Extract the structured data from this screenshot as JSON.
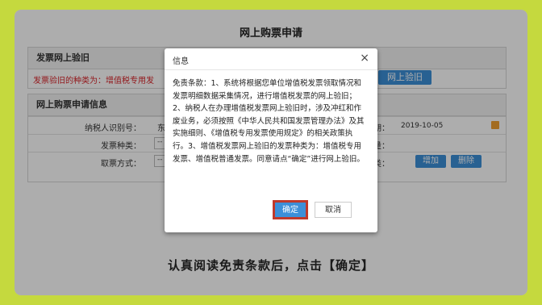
{
  "page_title": "网上购票申请",
  "verify_panel": {
    "title": "发票网上验旧",
    "type_text": "发票验旧的种类为：增值税专用发",
    "verify_button": "网上验旧"
  },
  "info_panel": {
    "title": "网上购票申请信息",
    "taxpayer_label": "纳税人识别号：",
    "taxpayer_value": "东",
    "invoice_type_label": "发票种类：",
    "invoice_type_value": "--",
    "pickup_label": "取票方式：",
    "pickup_value": "--",
    "date_label": "日期：",
    "date_value": "2019-10-05",
    "quantity_label": "数量：",
    "kind_label": "种类：",
    "add_button": "增加",
    "delete_button": "删除"
  },
  "dialog": {
    "title": "信息",
    "close": "×",
    "body": "免责条款：1、系统将根据您单位增值税发票领取情况和发票明细数据采集情况，进行增值税发票的网上验旧；2、纳税人在办理增值税发票网上验旧时，涉及冲红和作废业务，必须按照《中华人民共和国发票管理办法》及其实施细则、《增值税专用发票使用规定》的相关政策执行。3、增值税发票网上验旧的发票种类为：增值税专用发票、增值税普通发票。同意请点“确定”进行网上验旧。",
    "confirm": "确定",
    "cancel": "取消"
  },
  "caption": "认真阅读免责条款后，点击【确定】",
  "colors": {
    "border": "#c5d93e",
    "accent": "#3c8fd8",
    "highlight": "#c0392b",
    "warning_text": "#d9262c"
  }
}
